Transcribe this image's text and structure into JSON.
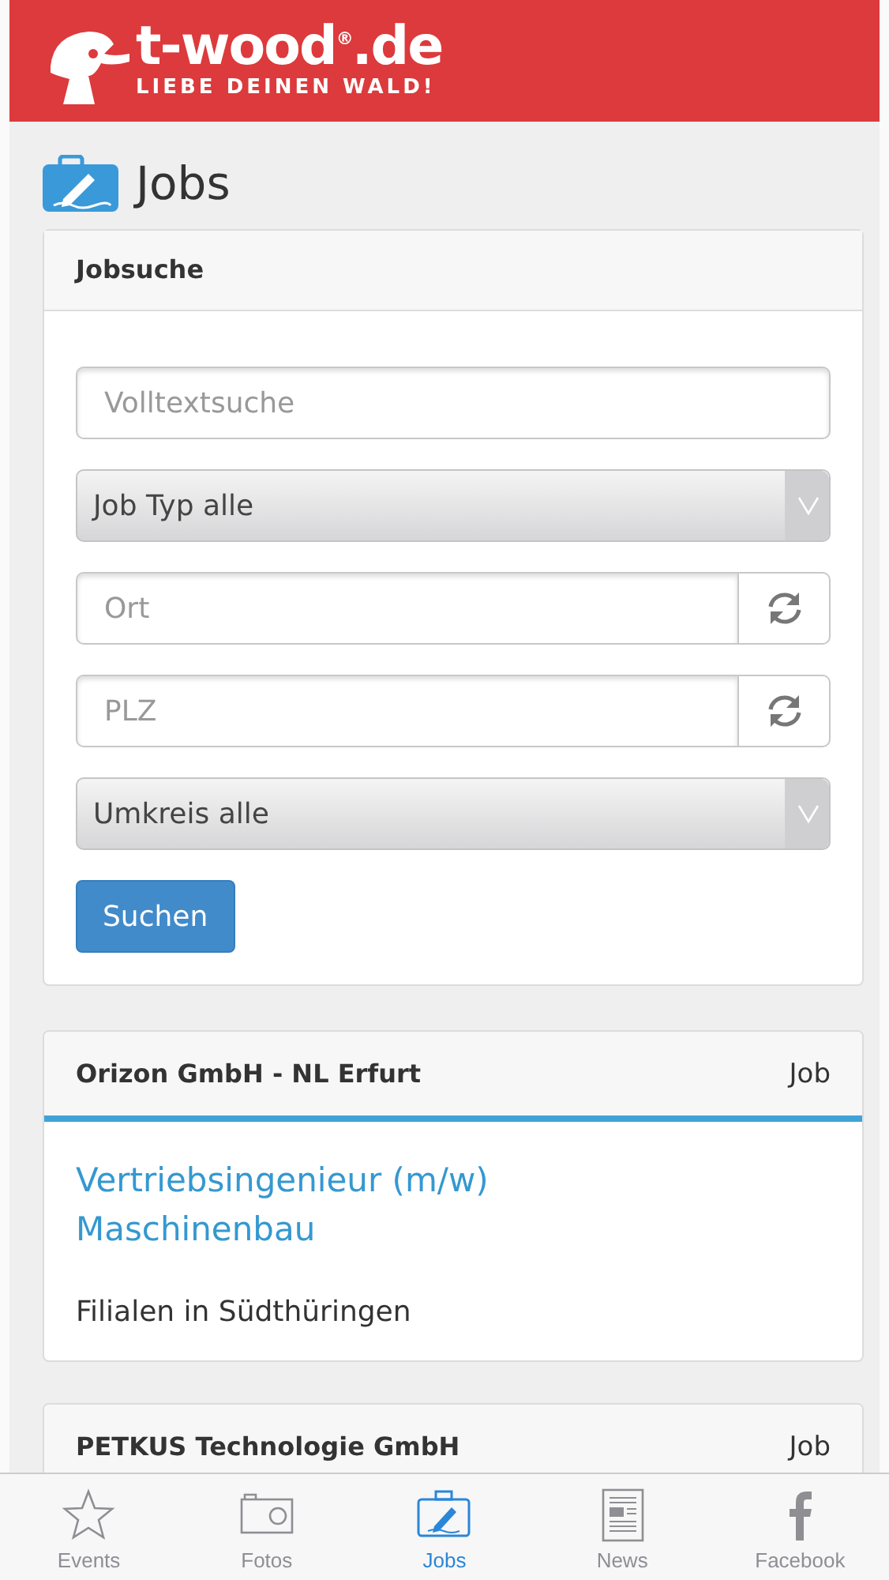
{
  "header": {
    "brand": "t-wood$^{®}$.de",
    "slogan": "LIEBE DEINEN WALD!"
  },
  "page_title": "Jobs",
  "search_card": {
    "title": "Jobsuche",
    "fields": [
      {
        "kind": "text",
        "placeholder": "Volltextsuche"
      },
      {
        "kind": "select",
        "value": "Job Typ alle"
      },
      {
        "kind": "locate",
        "placeholder": "Ort"
      },
      {
        "kind": "locate",
        "placeholder": "PLZ"
      },
      {
        "kind": "select",
        "value": "Umkreis alle"
      }
    ],
    "button": "Suchen"
  },
  "jobs": [
    {
      "company": "Orizon GmbH - NL Erfurt",
      "type": "Job",
      "title": "Vertriebsingenieur (m/w) Maschinenbau",
      "location": "Filialen in Südthüringen"
    },
    {
      "company": "PETKUS Technologie GmbH",
      "type": "Job"
    }
  ],
  "tabs": [
    {
      "label": "Events",
      "kind": "star",
      "selected": false
    },
    {
      "label": "Fotos",
      "kind": "camera",
      "selected": false
    },
    {
      "label": "Jobs",
      "kind": "case",
      "selected": true
    },
    {
      "label": "News",
      "kind": "news",
      "selected": false
    },
    {
      "label": "Facebook",
      "kind": "facebook",
      "selected": false
    }
  ]
}
